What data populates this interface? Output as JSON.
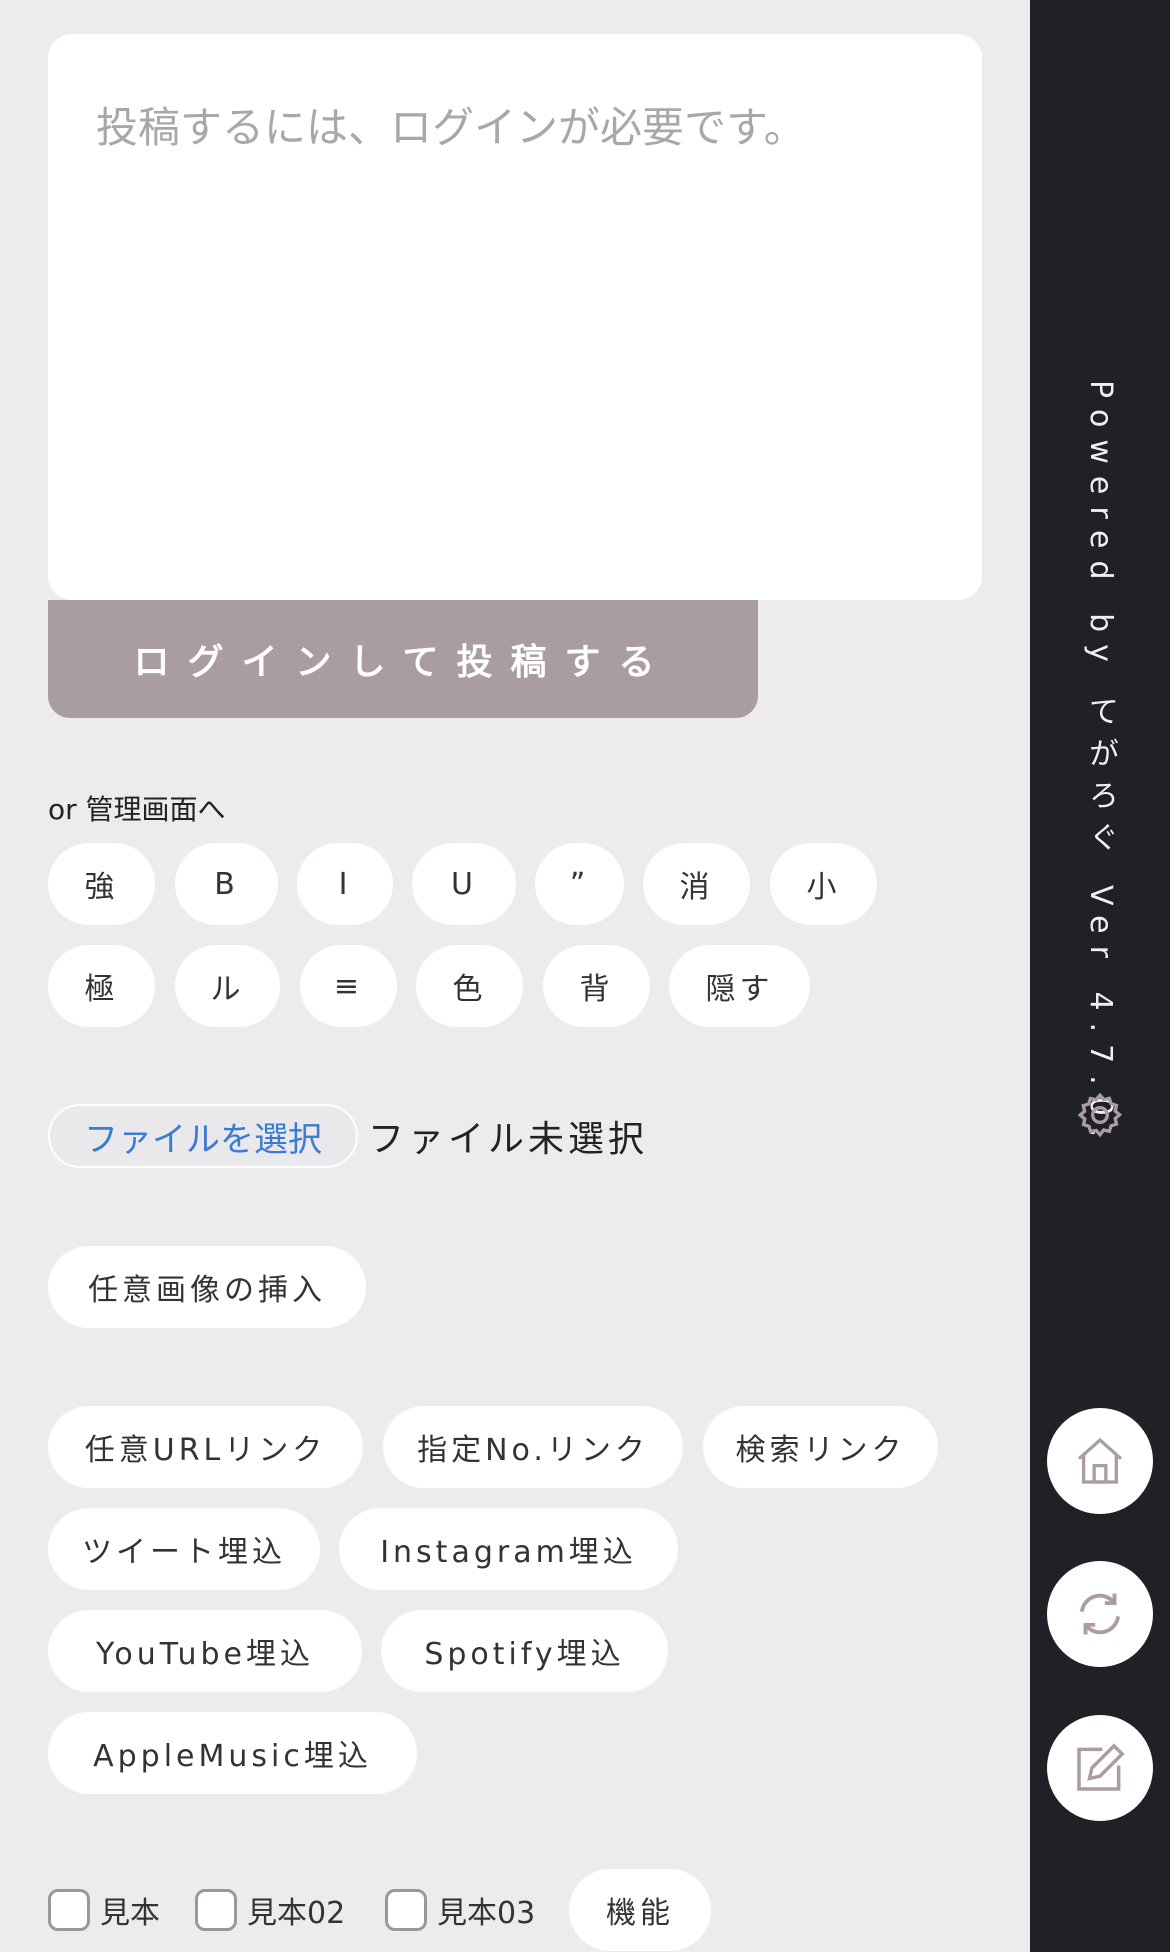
{
  "post": {
    "placeholder": "投稿するには、ログインが必要です。",
    "submit_label": "ログインして投稿する",
    "admin_link": "or 管理画面へ"
  },
  "format_buttons": {
    "row1": [
      "強",
      "B",
      "I",
      "U",
      "”",
      "消",
      "小"
    ],
    "row2": [
      "極",
      "ル",
      "≡",
      "色",
      "背",
      "隠す"
    ]
  },
  "file": {
    "choose_label": "ファイルを選択",
    "status": "ファイル未選択"
  },
  "insert_image_label": "任意画像の挿入",
  "link_buttons": {
    "row1": [
      "任意URLリンク",
      "指定No.リンク",
      "検索リンク"
    ],
    "row2": [
      "ツイート埋込",
      "Instagram埋込"
    ],
    "row3": [
      "YouTube埋込",
      "Spotify埋込"
    ],
    "row4": [
      "AppleMusic埋込"
    ]
  },
  "checkboxes": [
    "見本",
    "見本02",
    "見本03"
  ],
  "function_label": "機能",
  "sidebar": {
    "powered_by": "Powered by てがろぐ Ver 4.7.0.",
    "icons": [
      "gear-icon",
      "home-icon",
      "refresh-icon",
      "edit-icon"
    ]
  },
  "colors": {
    "background": "#edebec",
    "submit": "#aa9ca3",
    "sidebar": "#202126",
    "link": "#3a7bd5",
    "icon": "#aa9ca3"
  }
}
